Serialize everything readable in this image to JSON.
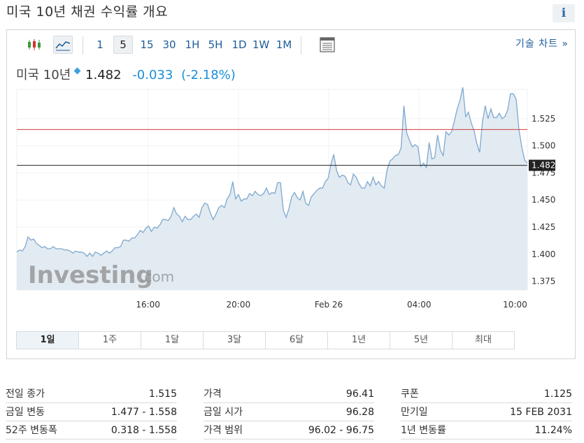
{
  "title": "미국 10년 채권 수익률 개요",
  "toolbar": {
    "intervals": [
      {
        "label": "1",
        "selected": false
      },
      {
        "label": "5",
        "selected": true
      },
      {
        "label": "15",
        "selected": false
      },
      {
        "label": "30",
        "selected": false
      },
      {
        "label": "1H",
        "selected": false
      },
      {
        "label": "5H",
        "selected": false
      },
      {
        "label": "1D",
        "selected": false
      },
      {
        "label": "1W",
        "selected": false
      },
      {
        "label": "1M",
        "selected": false
      }
    ],
    "tech_chart_label": "기술 차트 »"
  },
  "quote": {
    "name": "미국 10년",
    "price": "1.482",
    "change": "-0.033",
    "change_pct": "(-2.18%)"
  },
  "chart_data": {
    "type": "area",
    "x_tick_labels": [
      "16:00",
      "20:00",
      "Feb 26",
      "04:00",
      "10:00"
    ],
    "y_tick_labels": [
      "1.375",
      "1.400",
      "1.425",
      "1.450",
      "1.475",
      "1.500",
      "1.525"
    ],
    "ylim": [
      1.367,
      1.552
    ],
    "previous_close": 1.515,
    "current_price": 1.482,
    "current_label": "1.482",
    "values": [
      1.402,
      1.404,
      1.403,
      1.407,
      1.416,
      1.413,
      1.414,
      1.41,
      1.408,
      1.406,
      1.407,
      1.405,
      1.405,
      1.407,
      1.405,
      1.405,
      1.405,
      1.404,
      1.404,
      1.403,
      1.401,
      1.403,
      1.402,
      1.402,
      1.401,
      1.398,
      1.401,
      1.398,
      1.402,
      1.401,
      1.399,
      1.401,
      1.403,
      1.401,
      1.403,
      1.406,
      1.406,
      1.407,
      1.413,
      1.413,
      1.412,
      1.415,
      1.415,
      1.418,
      1.422,
      1.42,
      1.424,
      1.426,
      1.421,
      1.425,
      1.424,
      1.427,
      1.432,
      1.432,
      1.431,
      1.435,
      1.443,
      1.437,
      1.435,
      1.43,
      1.435,
      1.432,
      1.432,
      1.435,
      1.437,
      1.434,
      1.443,
      1.447,
      1.446,
      1.438,
      1.432,
      1.437,
      1.443,
      1.445,
      1.443,
      1.451,
      1.455,
      1.467,
      1.451,
      1.455,
      1.449,
      1.451,
      1.451,
      1.456,
      1.454,
      1.458,
      1.455,
      1.454,
      1.456,
      1.461,
      1.455,
      1.457,
      1.456,
      1.466,
      1.466,
      1.441,
      1.434,
      1.442,
      1.453,
      1.457,
      1.452,
      1.45,
      1.458,
      1.447,
      1.445,
      1.453,
      1.456,
      1.459,
      1.461,
      1.461,
      1.467,
      1.47,
      1.483,
      1.492,
      1.477,
      1.471,
      1.473,
      1.472,
      1.466,
      1.464,
      1.474,
      1.471,
      1.465,
      1.461,
      1.461,
      1.467,
      1.463,
      1.471,
      1.464,
      1.467,
      1.463,
      1.461,
      1.478,
      1.486,
      1.488,
      1.491,
      1.492,
      1.498,
      1.537,
      1.512,
      1.505,
      1.499,
      1.501,
      1.499,
      1.481,
      1.484,
      1.48,
      1.503,
      1.488,
      1.489,
      1.51,
      1.496,
      1.491,
      1.513,
      1.51,
      1.513,
      1.523,
      1.534,
      1.542,
      1.554,
      1.527,
      1.531,
      1.521,
      1.514,
      1.502,
      1.494,
      1.522,
      1.537,
      1.525,
      1.534,
      1.526,
      1.526,
      1.53,
      1.525,
      1.527,
      1.533,
      1.548,
      1.548,
      1.543,
      1.515,
      1.499,
      1.487,
      1.484
    ]
  },
  "range_tabs": [
    {
      "label": "1일",
      "selected": true
    },
    {
      "label": "1주",
      "selected": false
    },
    {
      "label": "1달",
      "selected": false
    },
    {
      "label": "3달",
      "selected": false
    },
    {
      "label": "6달",
      "selected": false
    },
    {
      "label": "1년",
      "selected": false
    },
    {
      "label": "5년",
      "selected": false
    },
    {
      "label": "최대",
      "selected": false
    }
  ],
  "stats": {
    "col1": [
      {
        "label": "전일 종가",
        "value": "1.515"
      },
      {
        "label": "금일 변동",
        "value": "1.477 - 1.558"
      },
      {
        "label": "52주 변동폭",
        "value": "0.318 - 1.558"
      }
    ],
    "col2": [
      {
        "label": "가격",
        "value": "96.41"
      },
      {
        "label": "금일 시가",
        "value": "96.28"
      },
      {
        "label": "가격 범위",
        "value": "96.02 - 96.75"
      }
    ],
    "col3": [
      {
        "label": "쿠폰",
        "value": "1.125"
      },
      {
        "label": "만기일",
        "value": "15 FEB 2031"
      },
      {
        "label": "1년 변동률",
        "value": "11.24%"
      }
    ]
  },
  "colors": {
    "accent": "#1f5c99",
    "change_negative": "#1a8fd8",
    "line": "#7fa8cf",
    "area": "#e2ebf2",
    "prev_close_line": "#d23b3b",
    "current_line": "#222222"
  }
}
